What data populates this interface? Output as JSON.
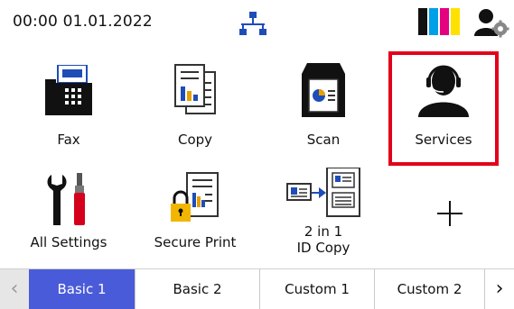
{
  "status": {
    "datetime": "00:00   01.01.2022",
    "icons": [
      "network-icon",
      "ink-levels-icon",
      "user-settings-icon"
    ]
  },
  "tiles": [
    {
      "label": "Fax",
      "icon": "fax-icon"
    },
    {
      "label": "Copy",
      "icon": "copy-icon"
    },
    {
      "label": "Scan",
      "icon": "scan-icon"
    },
    {
      "label": "Services",
      "icon": "headset-user-icon"
    },
    {
      "label": "All Settings",
      "icon": "tools-icon"
    },
    {
      "label": "Secure Print",
      "icon": "secure-print-icon"
    },
    {
      "label_line1": "2 in 1",
      "label_line2": "ID Copy",
      "icon": "id-copy-icon"
    },
    {
      "label": "",
      "icon": "add-icon"
    }
  ],
  "tabs": {
    "left_arrow": "‹",
    "right_arrow": "›",
    "items": [
      "Basic 1",
      "Basic 2",
      "Custom 1",
      "Custom 2"
    ],
    "active": "Basic 1"
  },
  "colors": {
    "accent_tab": "#4a5bd9",
    "highlight": "#e3001b",
    "ink_cyan": "#00a0e9",
    "ink_magenta": "#e4007f",
    "ink_yellow": "#ffe100",
    "ink_black": "#111111",
    "icon_blue": "#1f4db8"
  }
}
